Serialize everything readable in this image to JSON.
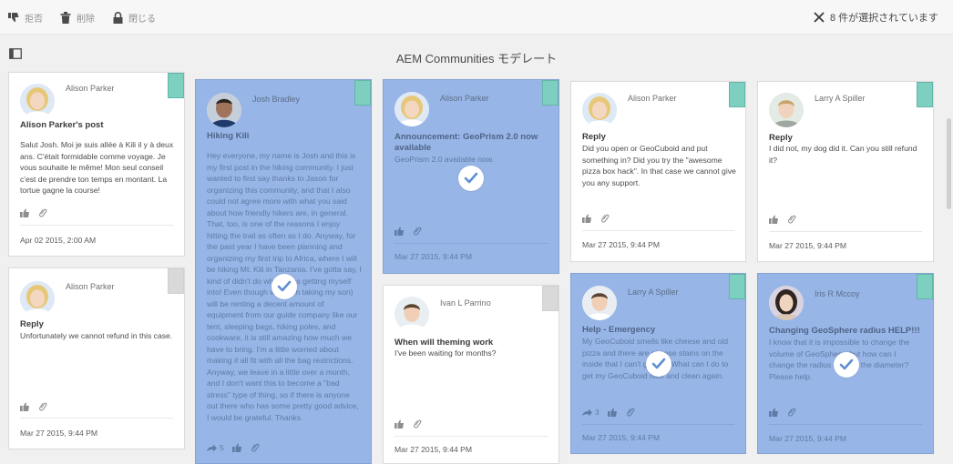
{
  "actionbar": {
    "reject_label": "拒否",
    "delete_label": "削除",
    "close_label": "閉じる",
    "selection_text": "8 件が選択されています"
  },
  "header": {
    "title": "AEM Communities モデレート"
  },
  "colors": {
    "selected_card": "#97b5e6",
    "flag_teal": "#7dcfc0",
    "flag_grey": "#d9d9d9",
    "check_blue": "#5f8ed2"
  },
  "cards": [
    {
      "author": "Alison Parker",
      "title": "Alison Parker's post",
      "body": "Salut Josh. Moi je suis allée à Kili il y à deux ans. C'était formidable comme voyage. Je vous souhaite le même! Mon seul conseil c'est de prendre ton temps en montant. La tortue gagne la course!",
      "date": "Apr 02 2015, 2:00 AM",
      "selected": false
    },
    {
      "author": "Alison Parker",
      "title": "Reply",
      "body": "Unfortunately we cannot refund in this case.",
      "date": "Mar 27 2015, 9:44 PM",
      "selected": false
    },
    {
      "author": "Josh Bradley",
      "title": "Hiking Kili",
      "body": "Hey everyone, my name is Josh and this is my first post in the hiking community. I just wanted to first say thanks to Jason for organizing this community, and that I also could not agree more with what you said about how friendly hikers are, in general. That, too, is one of the reasons I enjoy hitting the trail as often as I do. Anyway, for the past year I have been planning and organizing my first trip to Africa, where I will be hiking Mt. Kili in Tanzania. I've gotta say, I kind of didn't do what I was getting myself into! Even though we (I am taking my son) will be renting a decent amount of equipment from our guide company like our tent, sleeping bags, hiking poles, and cookware, it is still amazing how much we have to bring. I'm a little worried about making it all fit with all the bag restrictions. Anyway, we leave in a little over a month, and I don't want this to become a \"bad stress\" type of thing, so if there is anyone out there who has some pretty good advice, I would be grateful. Thanks.",
      "share_count": "5",
      "selected": true
    },
    {
      "author": "Alison Parker",
      "title": "Announcement: GeoPrism 2.0 now available",
      "body": "GeoPrism 2.0 available now.",
      "date": "Mar 27 2015, 9:44 PM",
      "selected": true
    },
    {
      "author": "Ivan L Parrino",
      "title": "When will theming work",
      "body": "I've been waiting for months?",
      "date": "Mar 27 2015, 9:44 PM",
      "selected": false
    },
    {
      "author": "Alison Parker",
      "title": "Reply",
      "body": "Did you open or GeoCuboid and put something in? Did you try the \"awesome pizza box hack\". In that case we cannot give you any support.",
      "date": "Mar 27 2015, 9:44 PM",
      "selected": false
    },
    {
      "author": "Larry A Spiller",
      "title": "Help - Emergency",
      "body": "My GeoCuboid smells like cheese and old pizza and there are cheese stains on the inside that I can't get out. What can I do to get my GeoCuboid nice and clean again.",
      "share_count": "3",
      "date": "Mar 27 2015, 9:44 PM",
      "selected": true
    },
    {
      "author": "Larry A Spiller",
      "title": "Reply",
      "body": "I did not, my dog did it. Can you still refund it?",
      "date": "Mar 27 2015, 9:44 PM",
      "selected": false
    },
    {
      "author": "Iris R Mccoy",
      "title": "Changing GeoSphere radius HELP!!!",
      "body": "I know that it is impossible to change the volume of GeoSphere, but how can I change the radius at least the diameter? Please help.",
      "date": "Mar 27 2015, 9:44 PM",
      "selected": true
    }
  ]
}
